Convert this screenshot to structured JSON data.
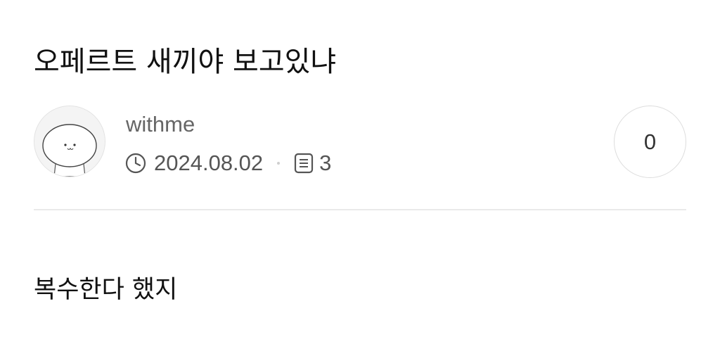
{
  "post": {
    "title": "오페르트 새끼야 보고있냐",
    "body": "복수한다 했지"
  },
  "author": {
    "name": "withme",
    "avatar_icon": "cartoon-character-avatar-icon"
  },
  "meta": {
    "date": "2024.08.02",
    "date_icon": "clock-icon",
    "comment_count": "3",
    "comment_icon": "document-list-icon"
  },
  "like": {
    "count": "0"
  },
  "colors": {
    "title": "#111111",
    "meta_text": "#555555",
    "author_text": "#666666",
    "divider": "#eaeaea",
    "border": "#dddddd"
  }
}
